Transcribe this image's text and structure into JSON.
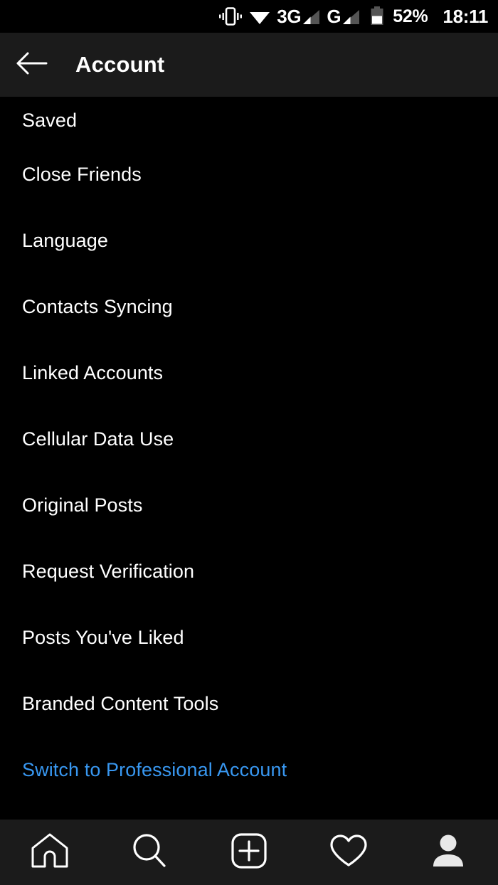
{
  "status_bar": {
    "vibrate_icon": "vibrate-icon",
    "wifi_icon": "wifi-icon",
    "network_type_1": "3G",
    "signal_icon_1": "signal-bars-icon",
    "network_type_2": "G",
    "signal_icon_2": "signal-bars-icon",
    "battery_icon": "battery-icon",
    "battery_percent": "52%",
    "time": "18:11"
  },
  "header": {
    "back_icon": "back-arrow-icon",
    "title": "Account"
  },
  "menu": {
    "items": [
      {
        "label": "Saved",
        "type": "normal",
        "name": "menu-item-saved"
      },
      {
        "label": "Close Friends",
        "type": "normal",
        "name": "menu-item-close-friends"
      },
      {
        "label": "Language",
        "type": "normal",
        "name": "menu-item-language"
      },
      {
        "label": "Contacts Syncing",
        "type": "normal",
        "name": "menu-item-contacts-syncing"
      },
      {
        "label": "Linked Accounts",
        "type": "normal",
        "name": "menu-item-linked-accounts"
      },
      {
        "label": "Cellular Data Use",
        "type": "normal",
        "name": "menu-item-cellular-data-use"
      },
      {
        "label": "Original Posts",
        "type": "normal",
        "name": "menu-item-original-posts"
      },
      {
        "label": "Request Verification",
        "type": "normal",
        "name": "menu-item-request-verification"
      },
      {
        "label": "Posts You've Liked",
        "type": "normal",
        "name": "menu-item-posts-youve-liked"
      },
      {
        "label": "Branded Content Tools",
        "type": "normal",
        "name": "menu-item-branded-content-tools"
      },
      {
        "label": "Switch to Professional Account",
        "type": "link",
        "name": "menu-item-switch-to-professional-account"
      }
    ]
  },
  "bottom_nav": {
    "items": [
      {
        "icon": "home-icon",
        "name": "nav-home",
        "active": false
      },
      {
        "icon": "search-icon",
        "name": "nav-search",
        "active": false
      },
      {
        "icon": "add-post-icon",
        "name": "nav-add-post",
        "active": false
      },
      {
        "icon": "heart-icon",
        "name": "nav-activity",
        "active": false
      },
      {
        "icon": "profile-icon",
        "name": "nav-profile",
        "active": true
      }
    ]
  },
  "colors": {
    "background": "#000000",
    "surface": "#1b1b1b",
    "text": "#ffffff",
    "link_blue": "#3897f0",
    "icon_dim": "#555555"
  }
}
